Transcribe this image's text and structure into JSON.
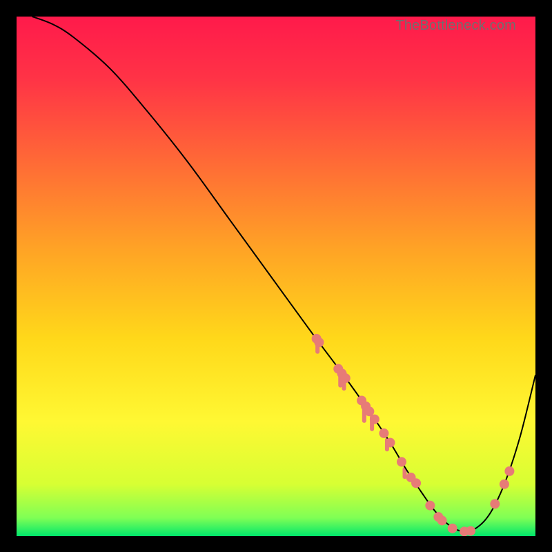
{
  "watermark": "TheBottleneck.com",
  "chart_data": {
    "type": "line",
    "title": "",
    "xlabel": "",
    "ylabel": "",
    "xlim": [
      0,
      100
    ],
    "ylim": [
      0,
      100
    ],
    "grid": false,
    "background_gradient": {
      "stops": [
        {
          "offset": 0.0,
          "color": "#ff1a4b"
        },
        {
          "offset": 0.12,
          "color": "#ff3346"
        },
        {
          "offset": 0.28,
          "color": "#ff6a36"
        },
        {
          "offset": 0.45,
          "color": "#ffa425"
        },
        {
          "offset": 0.62,
          "color": "#ffd81a"
        },
        {
          "offset": 0.78,
          "color": "#fff833"
        },
        {
          "offset": 0.9,
          "color": "#d7ff33"
        },
        {
          "offset": 0.965,
          "color": "#7fff55"
        },
        {
          "offset": 1.0,
          "color": "#00e66b"
        }
      ]
    },
    "series": [
      {
        "name": "curve",
        "color": "#000000",
        "width": 2,
        "x": [
          3,
          7,
          11,
          18,
          25,
          33,
          41,
          49,
          57,
          63,
          68,
          72,
          75,
          78,
          80.5,
          83,
          85.5,
          88,
          91,
          94,
          97,
          100
        ],
        "y": [
          100,
          98.5,
          96,
          90,
          82,
          72,
          61,
          50,
          39,
          31,
          24,
          18,
          13,
          8.5,
          5,
          2.4,
          1.0,
          1.2,
          4,
          10,
          19,
          31
        ]
      }
    ],
    "markers": [
      {
        "x": 57.8,
        "y": 38.0,
        "r": 7,
        "color": "#e77b77"
      },
      {
        "x": 58.3,
        "y": 37.3,
        "r": 7,
        "color": "#e77b77"
      },
      {
        "x": 62.0,
        "y": 32.2,
        "r": 7,
        "color": "#e77b77"
      },
      {
        "x": 62.7,
        "y": 31.3,
        "r": 7,
        "color": "#e77b77"
      },
      {
        "x": 63.4,
        "y": 30.4,
        "r": 7,
        "color": "#e77b77"
      },
      {
        "x": 66.5,
        "y": 26.1,
        "r": 7,
        "color": "#e77b77"
      },
      {
        "x": 67.3,
        "y": 25.0,
        "r": 7,
        "color": "#e77b77"
      },
      {
        "x": 68.0,
        "y": 24.0,
        "r": 7,
        "color": "#e77b77"
      },
      {
        "x": 69.0,
        "y": 22.5,
        "r": 7,
        "color": "#e77b77"
      },
      {
        "x": 70.8,
        "y": 19.8,
        "r": 7,
        "color": "#e77b77"
      },
      {
        "x": 72.0,
        "y": 18.0,
        "r": 7,
        "color": "#e77b77"
      },
      {
        "x": 74.2,
        "y": 14.3,
        "r": 7,
        "color": "#e77b77"
      },
      {
        "x": 76.0,
        "y": 11.3,
        "r": 7,
        "color": "#e77b77"
      },
      {
        "x": 77.0,
        "y": 10.2,
        "r": 7,
        "color": "#e77b77"
      },
      {
        "x": 79.7,
        "y": 5.9,
        "r": 7,
        "color": "#e77b77"
      },
      {
        "x": 81.3,
        "y": 3.7,
        "r": 7,
        "color": "#e77b77"
      },
      {
        "x": 82.0,
        "y": 3.0,
        "r": 7,
        "color": "#e77b77"
      },
      {
        "x": 84.0,
        "y": 1.5,
        "r": 7,
        "color": "#e77b77"
      },
      {
        "x": 86.3,
        "y": 0.9,
        "r": 7,
        "color": "#e77b77"
      },
      {
        "x": 87.5,
        "y": 1.0,
        "r": 7,
        "color": "#e77b77"
      },
      {
        "x": 92.2,
        "y": 6.2,
        "r": 7,
        "color": "#e77b77"
      },
      {
        "x": 94.0,
        "y": 10.0,
        "r": 7,
        "color": "#e77b77"
      },
      {
        "x": 95.0,
        "y": 12.5,
        "r": 7,
        "color": "#e77b77"
      }
    ],
    "drips": [
      {
        "x": 58.0,
        "y_top": 38.0,
        "y_bot": 35.1,
        "color": "#e77b77"
      },
      {
        "x": 62.4,
        "y_top": 31.8,
        "y_bot": 28.6,
        "color": "#e77b77"
      },
      {
        "x": 63.1,
        "y_top": 30.9,
        "y_bot": 28.0,
        "color": "#e77b77"
      },
      {
        "x": 67.0,
        "y_top": 25.5,
        "y_bot": 21.8,
        "color": "#e77b77"
      },
      {
        "x": 68.5,
        "y_top": 23.3,
        "y_bot": 20.2,
        "color": "#e77b77"
      },
      {
        "x": 71.4,
        "y_top": 18.9,
        "y_bot": 16.3,
        "color": "#e77b77"
      },
      {
        "x": 74.8,
        "y_top": 13.3,
        "y_bot": 11.0,
        "color": "#e77b77"
      }
    ]
  }
}
